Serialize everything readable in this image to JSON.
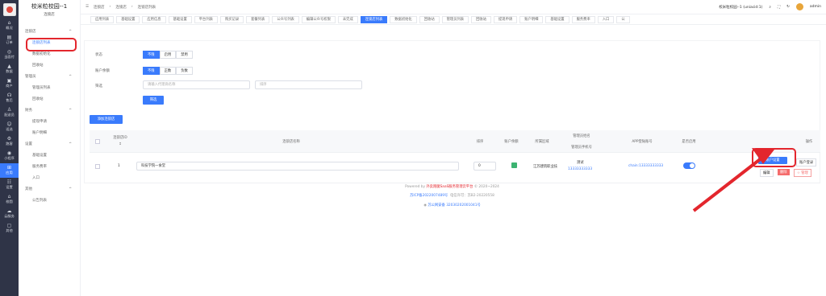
{
  "rail": [
    {
      "icon": "home-icon",
      "glyph": "⌂",
      "label": "概况"
    },
    {
      "icon": "order-icon",
      "glyph": "▤",
      "label": "订单"
    },
    {
      "icon": "pay-icon",
      "glyph": "◎",
      "label": "当面付"
    },
    {
      "icon": "data-icon",
      "glyph": "▲",
      "label": "数据"
    },
    {
      "icon": "merchant-icon",
      "glyph": "▣",
      "label": "商户"
    },
    {
      "icon": "headset-icon",
      "glyph": "☊",
      "label": "售后"
    },
    {
      "icon": "delivery-icon",
      "glyph": "♙",
      "label": "配送员"
    },
    {
      "icon": "run-icon",
      "glyph": "☺",
      "label": "适选"
    },
    {
      "icon": "gear-icon",
      "glyph": "⚙",
      "label": "跑客"
    },
    {
      "icon": "mini-icon",
      "glyph": "◉",
      "label": "小程序"
    },
    {
      "icon": "app-icon",
      "glyph": "⊞",
      "label": "应用"
    },
    {
      "icon": "settings-icon",
      "glyph": "☷",
      "label": "设置"
    },
    {
      "icon": "campus-icon",
      "glyph": "⌂",
      "label": "校園"
    },
    {
      "icon": "cloud-icon",
      "glyph": "☁",
      "label": "云服务"
    },
    {
      "icon": "other-icon",
      "glyph": "▢",
      "label": "其他"
    }
  ],
  "brand": {
    "title": "校米粒校园--1",
    "subtitle": "连锁店"
  },
  "sidebar": [
    {
      "type": "grp",
      "label": "连锁店",
      "caret": "^"
    },
    {
      "type": "mi",
      "label": "连锁店列表",
      "on": true
    },
    {
      "type": "mi",
      "label": "数据初始化"
    },
    {
      "type": "mi",
      "label": "回收站"
    },
    {
      "type": "grp",
      "label": "管理员",
      "caret": "^"
    },
    {
      "type": "mi",
      "label": "管理员列表"
    },
    {
      "type": "mi",
      "label": "回收站"
    },
    {
      "type": "grp",
      "label": "财务",
      "caret": "^"
    },
    {
      "type": "mi",
      "label": "提现申请"
    },
    {
      "type": "mi",
      "label": "账户明细"
    },
    {
      "type": "grp",
      "label": "设置",
      "caret": "^"
    },
    {
      "type": "mi",
      "label": "基础设置"
    },
    {
      "type": "mi",
      "label": "服务费率"
    },
    {
      "type": "mi",
      "label": "入口"
    },
    {
      "type": "grp",
      "label": "其他",
      "caret": "^"
    },
    {
      "type": "mi",
      "label": "公告列表"
    }
  ],
  "breadcrumb": [
    "连锁店",
    "连锁店",
    "连锁店列表"
  ],
  "topbar": {
    "account": "校米粒校园--1 (uniacid:1)",
    "user": "admin"
  },
  "tabs": [
    {
      "label": "应用列表"
    },
    {
      "label": "基础设置"
    },
    {
      "label": "应用信息"
    },
    {
      "label": "基础设置"
    },
    {
      "label": "平台列表"
    },
    {
      "label": "购买记录"
    },
    {
      "label": "套餐列表"
    },
    {
      "label": "公众号列表"
    },
    {
      "label": "编辑公众号权限"
    },
    {
      "label": "未完成"
    },
    {
      "label": "连锁店列表",
      "on": true
    },
    {
      "label": "数据初始化"
    },
    {
      "label": "回收站"
    },
    {
      "label": "管理员列表"
    },
    {
      "label": "回收站"
    },
    {
      "label": "提现申请"
    },
    {
      "label": "账户明细"
    },
    {
      "label": "基础设置"
    },
    {
      "label": "服务费率"
    },
    {
      "label": "入口"
    },
    {
      "label": "公"
    }
  ],
  "filters": {
    "status_label": "状态",
    "status_opts": [
      "不限",
      "启用",
      "禁用"
    ],
    "balance_label": "账户余额",
    "balance_opts": [
      "不限",
      "正数",
      "负数"
    ],
    "search_label": "筛选",
    "search_placeholder": "请输入代理商名称",
    "search2_placeholder": "排序",
    "filter_btn": "筛选"
  },
  "add_btn": "添加连锁店",
  "table": {
    "headers": {
      "id": "连锁店ID",
      "id2": "↕",
      "name": "连锁店名称",
      "sort": "排序",
      "bal": "账户余额",
      "area": "所属区域",
      "mgr": "管理员姓名",
      "mgr2": "管理员手机号",
      "app": "APP登陆账号",
      "enable": "是否启用",
      "ops": "操作"
    },
    "row": {
      "id": "1",
      "name": "科技学院一食堂",
      "sort": "0",
      "area": "江苏建筑职业技",
      "mgr_name": "测试",
      "mgr_phone": "13333333333",
      "app": "chain:13333333333",
      "btn_account": "账户设置",
      "btn_login": "账户登录",
      "btn_edit": "编辑",
      "btn_del": "删除",
      "btn_manage": "☆ 管理"
    }
  },
  "footer": {
    "line1_pre": "Powered by ",
    "line1_brand": "外卖跑腿SaaS服务管理云平台",
    "line1_post": " © 2020~2024",
    "icp": "苏ICP备2022007489号",
    "licence": "电信许可：苏B2-20220558",
    "gongan": "苏公网安备 32030202001041号"
  },
  "colors": {
    "accent": "#3a7bfc",
    "highlight": "#e3262d",
    "rail": "#2f3447",
    "toggle": "#3a7bfc",
    "danger": "#f56c6c"
  }
}
